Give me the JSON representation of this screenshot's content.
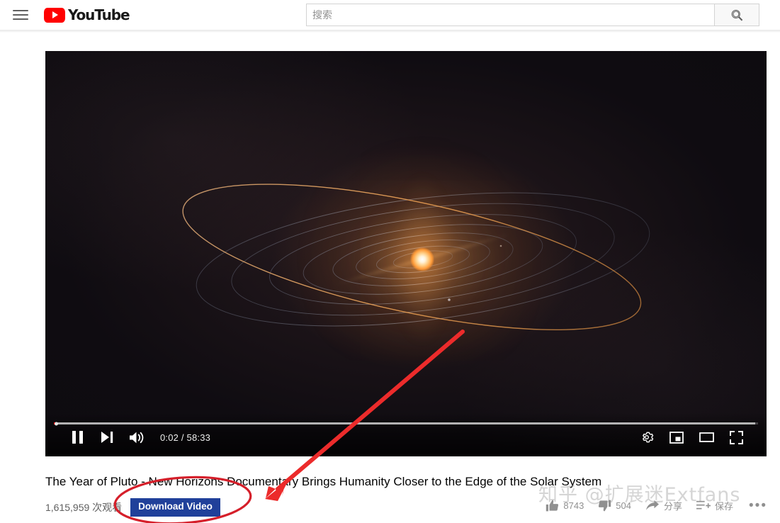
{
  "header": {
    "menu_icon": "hamburger-menu-icon",
    "logo_text": "YouTube",
    "logo_icon": "youtube-play-icon",
    "search": {
      "placeholder": "搜索",
      "value": "",
      "button_icon": "search-icon"
    }
  },
  "player": {
    "controls": {
      "play_pause_icon": "pause-icon",
      "next_icon": "next-video-icon",
      "volume_icon": "volume-on-icon",
      "time_display": "0:02 / 58:33",
      "current_time": "0:02",
      "duration": "58:33",
      "progress_percent": 0.35,
      "buffered_percent": 99.6,
      "settings_icon": "gear-icon",
      "miniplayer_icon": "miniplayer-icon",
      "theater_icon": "theater-mode-icon",
      "fullscreen_icon": "fullscreen-icon"
    },
    "scene": {
      "description": "solar system with sun and elliptical planetary orbits",
      "sun_color": "#ffd089",
      "orbit_color": "#aab4c8",
      "pluto_orbit_color": "#d08a46"
    }
  },
  "video": {
    "title": "The Year of Pluto - New Horizons Documentary Brings Humanity Closer to the Edge of the Solar System",
    "view_count": "1,615,959 次观看",
    "download_button": "Download Video",
    "actions": {
      "like_icon": "thumbs-up-icon",
      "like_count": "8743",
      "dislike_icon": "thumbs-down-icon",
      "dislike_count": "504",
      "share_icon": "share-arrow-icon",
      "share_label": "分享",
      "save_icon": "playlist-add-icon",
      "save_label": "保存",
      "more_label": "•••"
    }
  },
  "watermark": {
    "text": "知乎 @扩展迷Extfans"
  },
  "annotations": {
    "arrow_color": "#ec2b2b",
    "ellipse_color": "#d51f2a",
    "arrow_target": "download-video-button"
  },
  "colors": {
    "brand_red": "#ff0000",
    "download_blue": "#20409a",
    "annotation_red": "#ec2b2b",
    "text_primary": "#030303",
    "text_secondary": "#606060"
  }
}
